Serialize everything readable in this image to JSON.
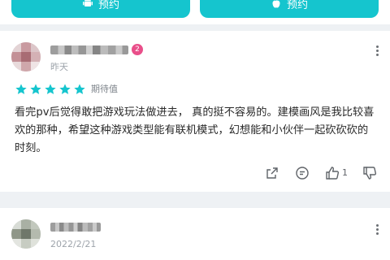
{
  "top_buttons": [
    {
      "label": "预约",
      "icon": "android-icon"
    },
    {
      "label": "预约",
      "icon": "apple-icon"
    }
  ],
  "reviews": [
    {
      "time": "昨天",
      "badge": "2",
      "rating": 5,
      "rating_label": "期待值",
      "text": "看完pv后觉得敢把游戏玩法做进去， 真的挺不容易的。建模画风是我比较喜欢的那种，希望这种游戏类型能有联机模式，幻想能和小伙伴一起砍砍砍的时刻。",
      "likes": "1",
      "action_icons": [
        "share-icon",
        "reply-icon",
        "thumbs-up-icon",
        "thumbs-down-icon"
      ]
    },
    {
      "time": "2022/2/21"
    }
  ],
  "colors": {
    "accent": "#15c5ce",
    "star": "#15c5ce",
    "badge": "#e94f8a"
  }
}
